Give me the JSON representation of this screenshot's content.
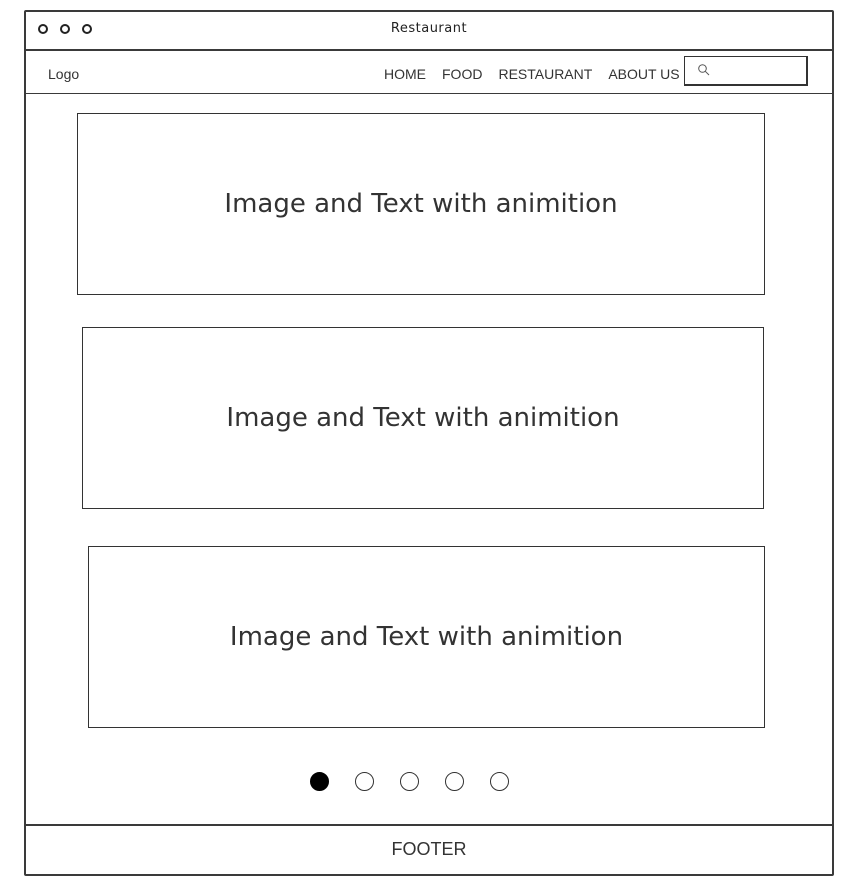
{
  "window": {
    "title": "Restaurant"
  },
  "navbar": {
    "logo": "Logo",
    "items": [
      {
        "label": "HOME"
      },
      {
        "label": "FOOD"
      },
      {
        "label": "RESTAURANT"
      },
      {
        "label": "ABOUT US"
      }
    ],
    "search": {
      "icon": "search-icon",
      "value": ""
    }
  },
  "panels": [
    {
      "text": "Image and Text with animition"
    },
    {
      "text": "Image and Text with animition"
    },
    {
      "text": "Image and Text with animition"
    }
  ],
  "pager": {
    "count": 5,
    "active_index": 0
  },
  "footer": {
    "label": "FOOTER"
  }
}
